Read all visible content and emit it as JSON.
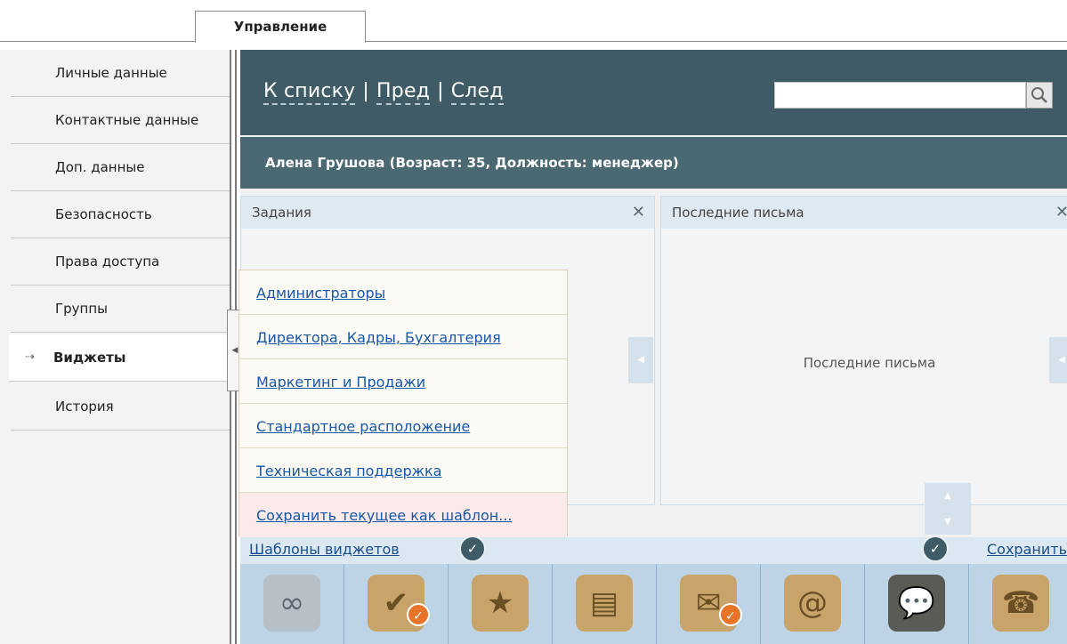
{
  "tab": {
    "label": "Управление"
  },
  "sidebar": {
    "items": [
      {
        "label": "Личные данные"
      },
      {
        "label": "Контактные данные"
      },
      {
        "label": "Доп. данные"
      },
      {
        "label": "Безопасность"
      },
      {
        "label": "Права доступа"
      },
      {
        "label": "Группы"
      },
      {
        "label": "Виджеты",
        "active": true
      },
      {
        "label": "История"
      }
    ],
    "active_marker": "⇢"
  },
  "nav": {
    "to_list": "К списку",
    "prev": "Пред",
    "next": "След",
    "separator": "|"
  },
  "search": {
    "value": "",
    "placeholder": "",
    "icon": "search-icon"
  },
  "person": {
    "title": "Алена Грушова (Возраст: 35, Должность: менеджер)"
  },
  "widgets": {
    "tasks": {
      "title": "Задания",
      "close": "✕"
    },
    "mail": {
      "title": "Последние письма",
      "close": "✕",
      "body": "Последние письма"
    }
  },
  "templates_menu": {
    "items": [
      "Администраторы",
      "Директора, Кадры, Бухгалтерия",
      "Маркетинг и Продажи",
      "Стандартное расположение",
      "Техническая поддержка"
    ],
    "save_as": "Сохранить текущее как шаблон..."
  },
  "template_bar": {
    "templates_link": "Шаблоны виджетов",
    "save_link": "Сохранить",
    "icons": [
      "link-icon",
      "task-check-icon",
      "favorites-star-icon",
      "folder-icon",
      "mail-check-icon",
      "email-icon",
      "chat-board-icon",
      "phone-icon"
    ]
  },
  "colors": {
    "nav_bg": "#3f5c66",
    "person_bg": "#4b6973",
    "link": "#1a57a8",
    "accent_orange": "#e8742a"
  }
}
